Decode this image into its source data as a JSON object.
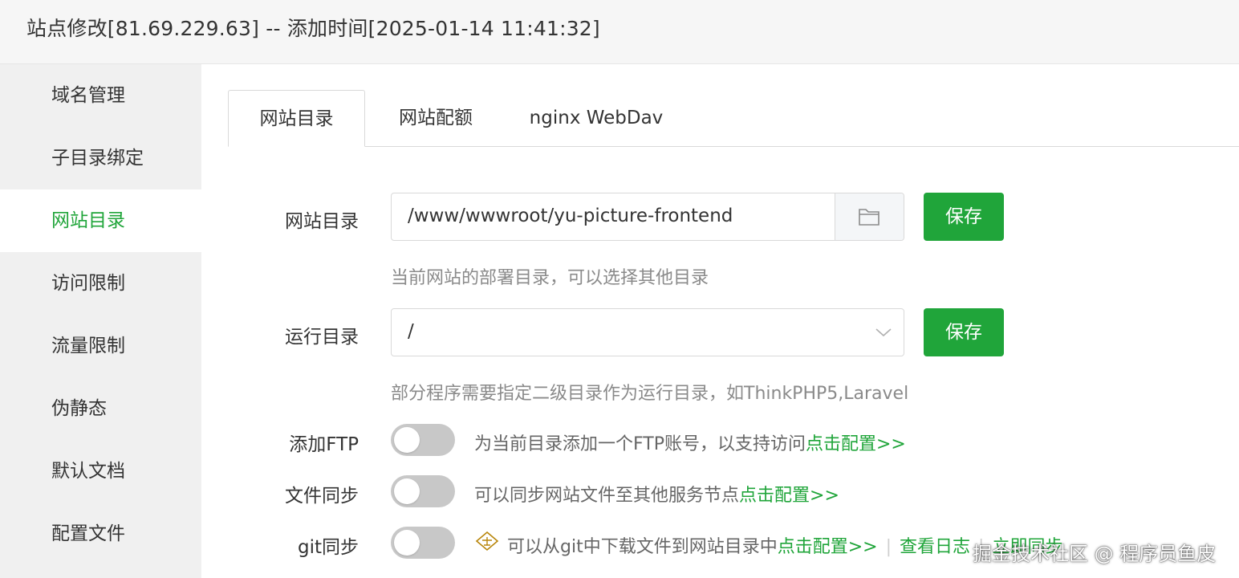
{
  "header": {
    "title": "站点修改[81.69.229.63] -- 添加时间[2025-01-14 11:41:32]"
  },
  "sidebar": {
    "items": [
      {
        "label": "域名管理"
      },
      {
        "label": "子目录绑定"
      },
      {
        "label": "网站目录",
        "active": true
      },
      {
        "label": "访问限制"
      },
      {
        "label": "流量限制"
      },
      {
        "label": "伪静态"
      },
      {
        "label": "默认文档"
      },
      {
        "label": "配置文件"
      }
    ]
  },
  "tabs": [
    {
      "label": "网站目录",
      "active": true
    },
    {
      "label": "网站配额"
    },
    {
      "label": "nginx WebDav"
    }
  ],
  "site_dir": {
    "label": "网站目录",
    "value": "/www/wwwroot/yu-picture-frontend",
    "browse_icon": "folder-icon",
    "save_label": "保存",
    "hint": "当前网站的部署目录，可以选择其他目录"
  },
  "run_dir": {
    "label": "运行目录",
    "value": "/",
    "save_label": "保存",
    "hint": "部分程序需要指定二级目录作为运行目录，如ThinkPHP5,Laravel"
  },
  "ftp": {
    "label": "添加FTP",
    "enabled": false,
    "desc": "为当前目录添加一个FTP账号，以支持访问",
    "link": "点击配置>>"
  },
  "file_sync": {
    "label": "文件同步",
    "enabled": false,
    "desc": "可以同步网站文件至其他服务节点",
    "link": "点击配置>>"
  },
  "git_sync": {
    "label": "git同步",
    "enabled": false,
    "badge_icon": "enterprise-badge-icon",
    "desc": "可以从git中下载文件到网站目录中",
    "link": "点击配置>>",
    "log_link": "查看日志",
    "sync_now_link": "立即同步"
  },
  "watermark": "掘金技术社区 @ 程序员鱼皮",
  "colors": {
    "accent": "#20a53a",
    "sidebar_bg": "#f0f0f0",
    "toggle_off": "#c8c8c8"
  }
}
